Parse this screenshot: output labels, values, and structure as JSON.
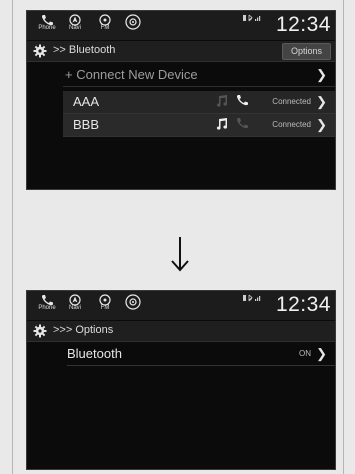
{
  "screen1": {
    "status": {
      "phone_label": "Phone",
      "navi_label": "Navi",
      "fm_label": "FM",
      "clock": "12:34"
    },
    "breadcrumb": ">> Bluetooth",
    "options_button": "Options",
    "connect_row": {
      "label": "+ Connect New Device"
    },
    "devices": [
      {
        "name": "AAA",
        "status": "Connected",
        "media_active": false,
        "call_active": true
      },
      {
        "name": "BBB",
        "status": "Connected",
        "media_active": true,
        "call_active": false
      }
    ]
  },
  "screen2": {
    "status": {
      "phone_label": "Phone",
      "navi_label": "Navi",
      "fm_label": "FM",
      "clock": "12:34"
    },
    "breadcrumb": ">>> Options",
    "row": {
      "label": "Bluetooth",
      "value": "ON"
    }
  },
  "colors": {
    "screen_bg": "#0b0b0b",
    "text": "#e6e6e6",
    "dim_icon": "#555555"
  }
}
